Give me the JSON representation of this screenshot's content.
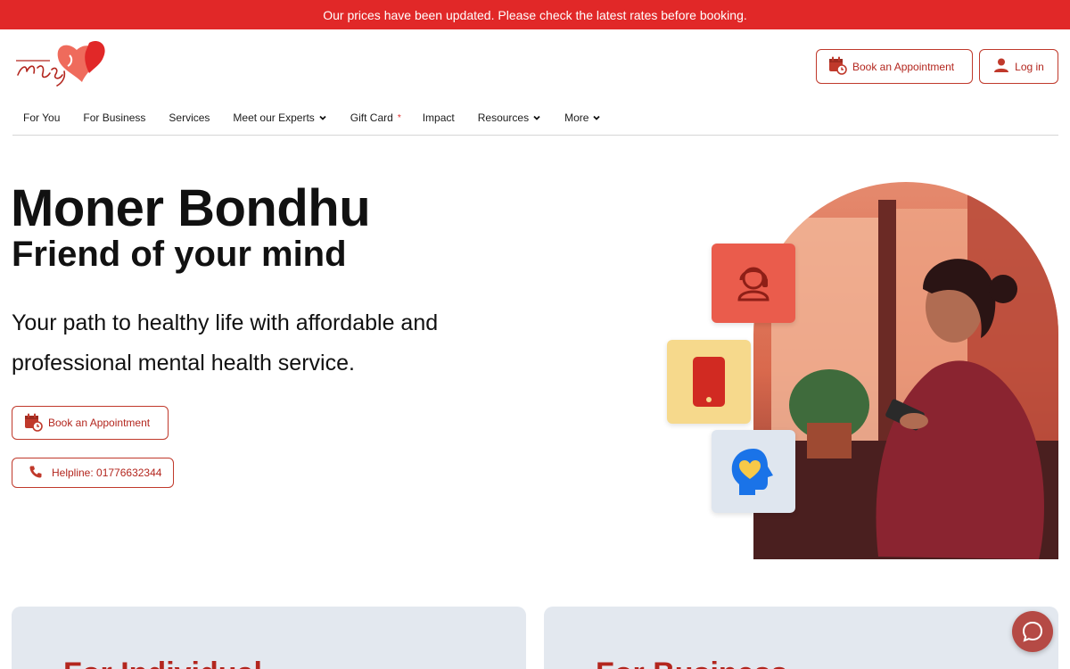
{
  "banner": {
    "text": "Our prices have been updated. Please check the latest rates before booking."
  },
  "header": {
    "book_label": "Book an Appointment",
    "login_label": "Log in"
  },
  "nav": {
    "items": [
      {
        "label": "For You",
        "dropdown": false
      },
      {
        "label": "For Business",
        "dropdown": false
      },
      {
        "label": "Services",
        "dropdown": false
      },
      {
        "label": "Meet our Experts",
        "dropdown": true
      },
      {
        "label": "Gift Card",
        "dropdown": false,
        "marker": "*"
      },
      {
        "label": "Impact",
        "dropdown": false
      },
      {
        "label": "Resources",
        "dropdown": true
      },
      {
        "label": "More",
        "dropdown": true
      }
    ]
  },
  "hero": {
    "title": "Moner Bondhu",
    "subtitle": "Friend of your mind",
    "description": "Your path to healthy life with affordable and professional mental health service.",
    "book_label": "Book an Appointment",
    "helpline_label": "Helpline: 01776632344"
  },
  "cards": [
    {
      "title": "For Individual"
    },
    {
      "title": "For Business"
    }
  ],
  "colors": {
    "brand_red": "#e12828",
    "button_text": "#b3261e",
    "card_bg": "#e3e8ef",
    "chat_button": "#b54a45"
  },
  "icons": {
    "calendar": "calendar-clock-icon",
    "user": "user-icon",
    "phone": "phone-icon",
    "chat": "chat-bubble-icon",
    "chevron": "chevron-down-icon"
  }
}
